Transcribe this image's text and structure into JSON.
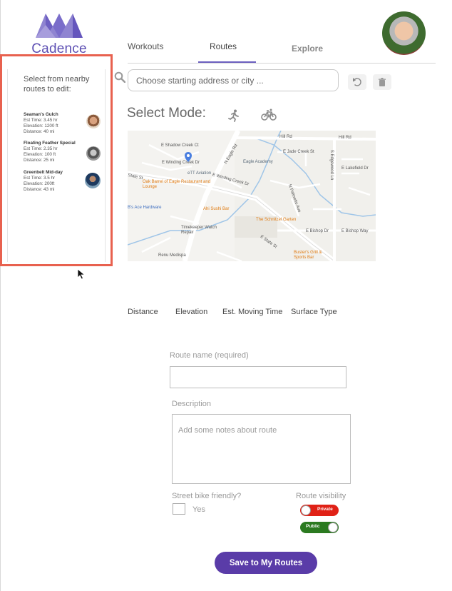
{
  "app": {
    "name": "Cadence",
    "brand_color": "#5d4fb3"
  },
  "nav": {
    "tabs": [
      {
        "label": "Workouts"
      },
      {
        "label": "Routes",
        "active": true
      },
      {
        "label": "Explore"
      }
    ]
  },
  "sidebar": {
    "title": "Select from nearby routes to edit:",
    "routes": [
      {
        "name": "Seaman's Gulch",
        "time": "Est Time: 3.45 hr",
        "elevation": "Elevation: 1200 ft",
        "distance": "Distance: 40 mi"
      },
      {
        "name": "Floating Feather Special",
        "time": "Est Time: 2.35 hr",
        "elevation": "Elevation: 100 ft",
        "distance": "Distance: 25 mi"
      },
      {
        "name": "Greenbelt Mid-day",
        "time": "Est Time:  3.5 hr",
        "elevation": "Elevation: 200ft",
        "distance": "Distance: 43 mi"
      }
    ]
  },
  "search": {
    "placeholder": "Choose starting address or city ..."
  },
  "mode": {
    "label": "Select Mode:",
    "options": [
      "run-icon",
      "bike-icon"
    ]
  },
  "map": {
    "labels": [
      "Hill Rd",
      "E Shadow Creek Ct",
      "E Winding Creek Dr",
      "N Eagle Rd",
      "Eagle Academy",
      "eTT Aviation",
      "Oak Barrel of Eagle Restaurant and Lounge",
      "E Winding Creek Dr",
      "B's Ace Hardware",
      "Ahi Sushi Bar",
      "The Schnitzel Garten",
      "Timekeeper Watch Repair",
      "E State St",
      "Renu Medispa",
      "Buster's Grill & Sports Bar",
      "E Bishop Dr",
      "E Bishop Way",
      "E Jade Creek St",
      "E Lakefield Dr",
      "S Edgewood Ln",
      "State St",
      "N Palmetto Ave"
    ]
  },
  "stats": {
    "distance": "Distance",
    "elevation": "Elevation",
    "moving_time": "Est. Moving Time",
    "surface": "Surface Type"
  },
  "form": {
    "route_name_label": "Route name (required)",
    "description_label": "Description",
    "description_placeholder": "Add some notes about route",
    "bike_friendly_label": "Street bike friendly?",
    "yes_label": "Yes",
    "visibility_label": "Route visibility",
    "private_label": "Private",
    "public_label": "Public",
    "save_label": "Save to My Routes"
  },
  "colors": {
    "accent": "#5a3ca8",
    "highlight_border": "#e8614f",
    "private": "#e02116",
    "public": "#2b7a20"
  }
}
